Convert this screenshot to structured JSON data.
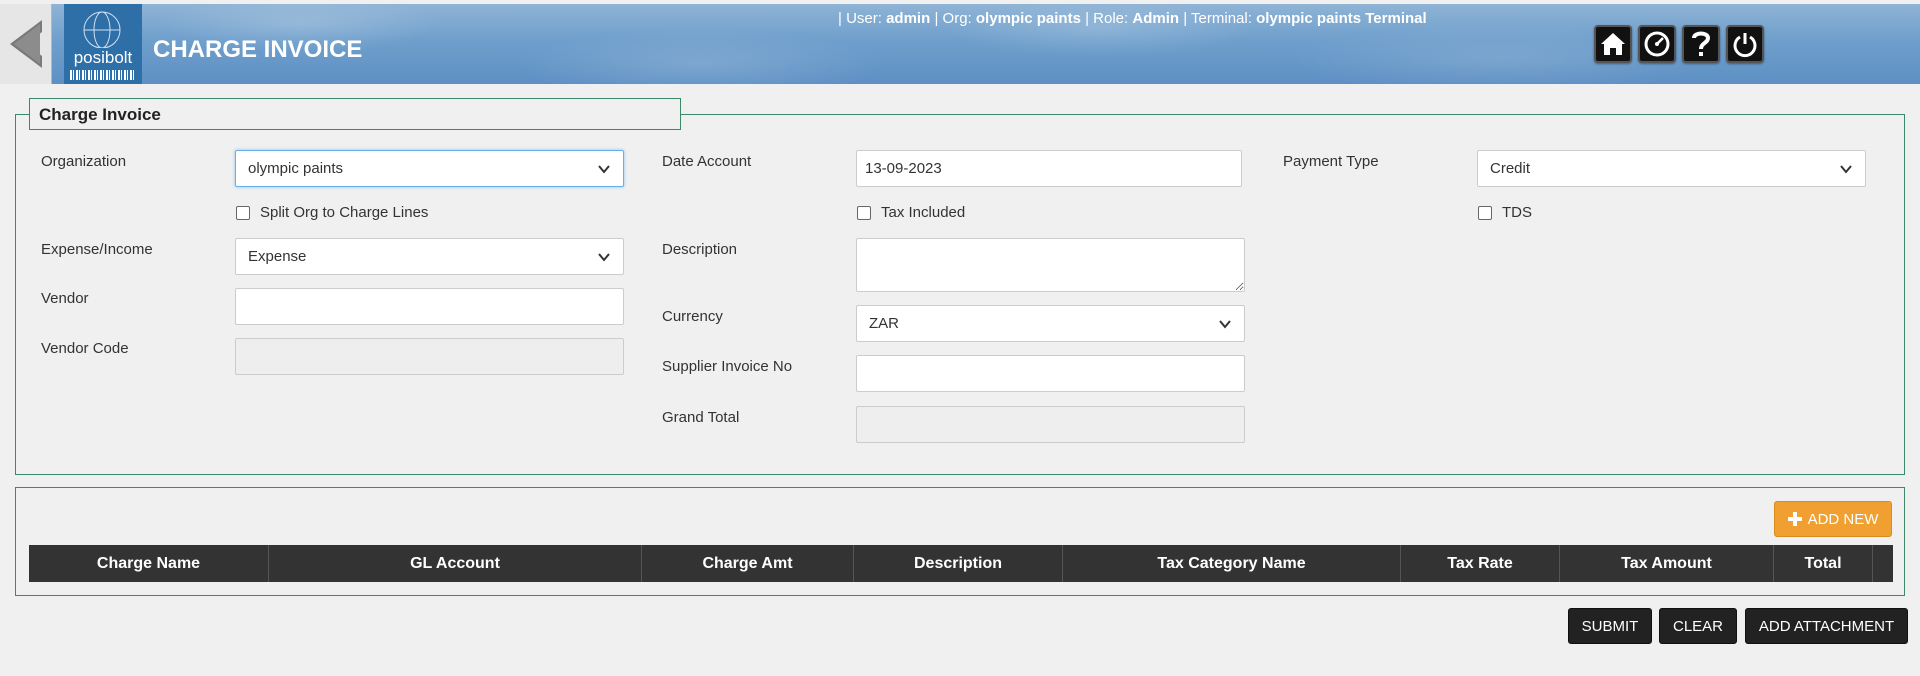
{
  "header": {
    "back_label": "Back",
    "logo_text": "posibolt",
    "title": "CHARGE INVOICE",
    "user_info": {
      "sep": "|",
      "user_label": "User:",
      "user": "admin",
      "org_label": "Org:",
      "org": "olympic paints",
      "role_label": "Role:",
      "role": "Admin",
      "terminal_label": "Terminal:",
      "terminal": "olympic paints Terminal"
    },
    "icons": [
      "home-icon",
      "dashboard-icon",
      "help-icon",
      "power-icon"
    ]
  },
  "form": {
    "legend": "Charge Invoice",
    "organization": {
      "label": "Organization",
      "value": "olympic paints"
    },
    "split_org": {
      "label": "Split Org to Charge Lines",
      "checked": false
    },
    "expense_income": {
      "label": "Expense/Income",
      "value": "Expense"
    },
    "vendor": {
      "label": "Vendor",
      "value": ""
    },
    "vendor_code": {
      "label": "Vendor Code",
      "value": ""
    },
    "date_account": {
      "label": "Date Account",
      "value": "13-09-2023"
    },
    "tax_included": {
      "label": "Tax Included",
      "checked": false
    },
    "description": {
      "label": "Description",
      "value": ""
    },
    "currency": {
      "label": "Currency",
      "value": "ZAR"
    },
    "supplier_invoice_no": {
      "label": "Supplier Invoice No",
      "value": ""
    },
    "grand_total": {
      "label": "Grand Total",
      "value": ""
    },
    "payment_type": {
      "label": "Payment Type",
      "value": "Credit"
    },
    "tds": {
      "label": "TDS",
      "checked": false
    }
  },
  "lines": {
    "add_new_label": "ADD NEW",
    "columns": [
      "Charge Name",
      "GL Account",
      "Charge Amt",
      "Description",
      "Tax Category Name",
      "Tax Rate",
      "Tax Amount",
      "Total"
    ]
  },
  "actions": {
    "submit": "SUBMIT",
    "clear": "CLEAR",
    "add_attachment": "ADD ATTACHMENT"
  },
  "colors": {
    "header_blue": "#6f9fcc",
    "accent_orange": "#f0a030",
    "border_green": "#3a8a6a",
    "grid_header": "#333333"
  }
}
